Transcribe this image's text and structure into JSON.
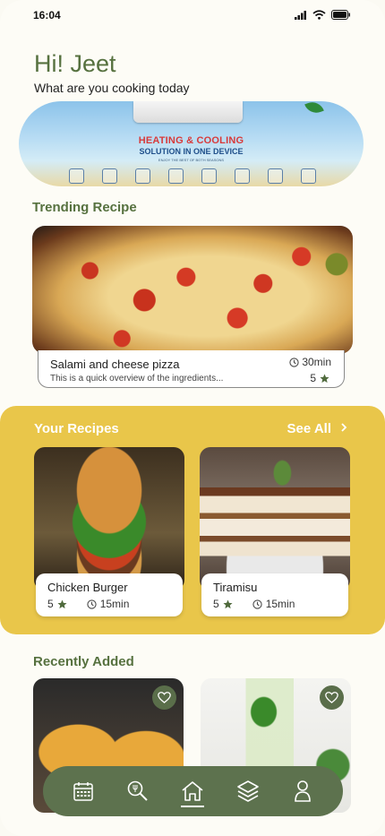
{
  "status_bar": {
    "time": "16:04"
  },
  "header": {
    "greeting": "Hi! Jeet",
    "subtitle": "What are you cooking today"
  },
  "banner": {
    "line1": "HEATING & COOLING",
    "line2": "SOLUTION IN ONE DEVICE",
    "line3": "ENJOY THE BEST OF BOTH SEASONS"
  },
  "trending": {
    "title": "Trending Recipe",
    "recipe": {
      "name": "Salami and cheese pizza",
      "description": "This is a quick overview of the ingredients...",
      "time": "30min",
      "rating": "5"
    }
  },
  "your_recipes": {
    "title": "Your Recipes",
    "see_all": "See All",
    "see_all_icon": "chevron-right-icon",
    "items": [
      {
        "name": "Chicken Burger",
        "rating": "5",
        "time": "15min"
      },
      {
        "name": "Tiramisu",
        "rating": "5",
        "time": "15min"
      }
    ]
  },
  "recently_added": {
    "title": "Recently Added"
  },
  "bottom_nav": {
    "items": [
      "calendar-icon",
      "search-icon",
      "home-icon",
      "layers-icon",
      "profile-icon"
    ],
    "active": "home-icon"
  },
  "colors": {
    "accent_green": "#56713f",
    "nav_green": "#5d724e",
    "yellow": "#e9c64a",
    "background": "#fdfcf6"
  }
}
